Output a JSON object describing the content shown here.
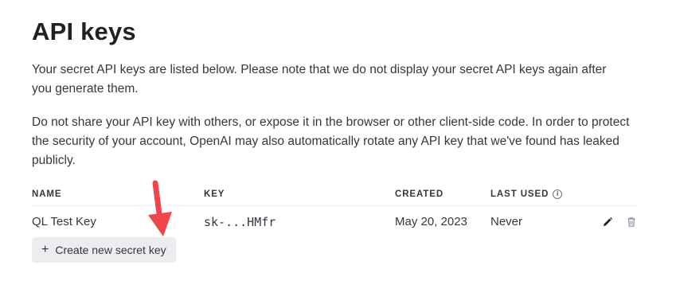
{
  "page": {
    "title": "API keys",
    "intro": "Your secret API keys are listed below. Please note that we do not display your secret API keys again after you generate them.",
    "warning": "Do not share your API key with others, or expose it in the browser or other client-side code. In order to protect the security of your account, OpenAI may also automatically rotate any API key that we've found has leaked publicly."
  },
  "table": {
    "headers": {
      "name": "NAME",
      "key": "KEY",
      "created": "CREATED",
      "last_used": "LAST USED",
      "last_used_info_icon": "info-icon"
    },
    "rows": [
      {
        "name": "QL Test Key",
        "key": "sk-...HMfr",
        "created": "May 20, 2023",
        "last_used": "Never",
        "actions": [
          "edit-icon",
          "trash-icon"
        ]
      }
    ]
  },
  "actions": {
    "create_label": "Create new secret key",
    "create_icon": "plus-icon",
    "create_icon_glyph": "+"
  },
  "annotation": {
    "icon": "arrow-down-icon",
    "color": "#f0454b"
  },
  "colors": {
    "text": "#353740",
    "heading": "#202123",
    "button_bg": "#ececf1",
    "divider": "#ececf1"
  }
}
